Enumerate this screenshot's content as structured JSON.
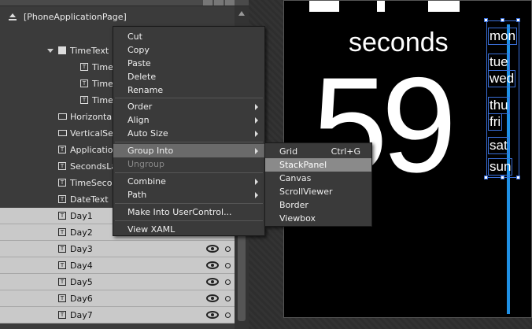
{
  "tree": {
    "root_label": "[PhoneApplicationPage]",
    "items": [
      {
        "label": "TimeText",
        "icon": "grid-icon"
      },
      {
        "label": "TimeHo",
        "icon": "textblock-icon"
      },
      {
        "label": "TimeDo",
        "icon": "textblock-icon"
      },
      {
        "label": "TimeMi",
        "icon": "textblock-icon"
      },
      {
        "label": "Horizontal",
        "icon": "rectangle-icon"
      },
      {
        "label": "VerticalSep",
        "icon": "rectangle-icon"
      },
      {
        "label": "Applicatio",
        "icon": "textblock-icon"
      },
      {
        "label": "SecondsLa",
        "icon": "textblock-icon"
      },
      {
        "label": "TimeSecon",
        "icon": "textblock-icon"
      },
      {
        "label": "DateText",
        "icon": "textblock-icon"
      },
      {
        "label": "Day1",
        "icon": "textblock-icon",
        "selected": true
      },
      {
        "label": "Day2",
        "icon": "textblock-icon",
        "selected": true
      },
      {
        "label": "Day3",
        "icon": "textblock-icon",
        "selected": true
      },
      {
        "label": "Day4",
        "icon": "textblock-icon",
        "selected": true
      },
      {
        "label": "Day5",
        "icon": "textblock-icon",
        "selected": true
      },
      {
        "label": "Day6",
        "icon": "textblock-icon",
        "selected": true
      },
      {
        "label": "Day7",
        "icon": "textblock-icon",
        "selected": true
      }
    ]
  },
  "context_menu": {
    "items": [
      {
        "label": "Cut"
      },
      {
        "label": "Copy"
      },
      {
        "label": "Paste"
      },
      {
        "label": "Delete"
      },
      {
        "label": "Rename"
      },
      {
        "label": "Order",
        "submenu": true
      },
      {
        "label": "Align",
        "submenu": true
      },
      {
        "label": "Auto Size",
        "submenu": true
      },
      {
        "label": "Group Into",
        "submenu": true,
        "highlighted": true
      },
      {
        "label": "Ungroup",
        "disabled": true
      },
      {
        "label": "Combine",
        "submenu": true
      },
      {
        "label": "Path",
        "submenu": true
      },
      {
        "label": "Make Into UserControl..."
      },
      {
        "label": "View XAML"
      }
    ]
  },
  "group_into_submenu": {
    "items": [
      {
        "label": "Grid",
        "shortcut": "Ctrl+G"
      },
      {
        "label": "StackPanel",
        "highlighted": true
      },
      {
        "label": "Canvas"
      },
      {
        "label": "ScrollViewer"
      },
      {
        "label": "Border"
      },
      {
        "label": "Viewbox"
      }
    ]
  },
  "artboard": {
    "seconds_label": "seconds",
    "seconds_value": "59",
    "days": [
      "mon",
      "tue",
      "wed",
      "thu",
      "fri",
      "sat",
      "sun"
    ],
    "separator_color": "#1e90e6",
    "selection_color": "#3a6fd8"
  }
}
